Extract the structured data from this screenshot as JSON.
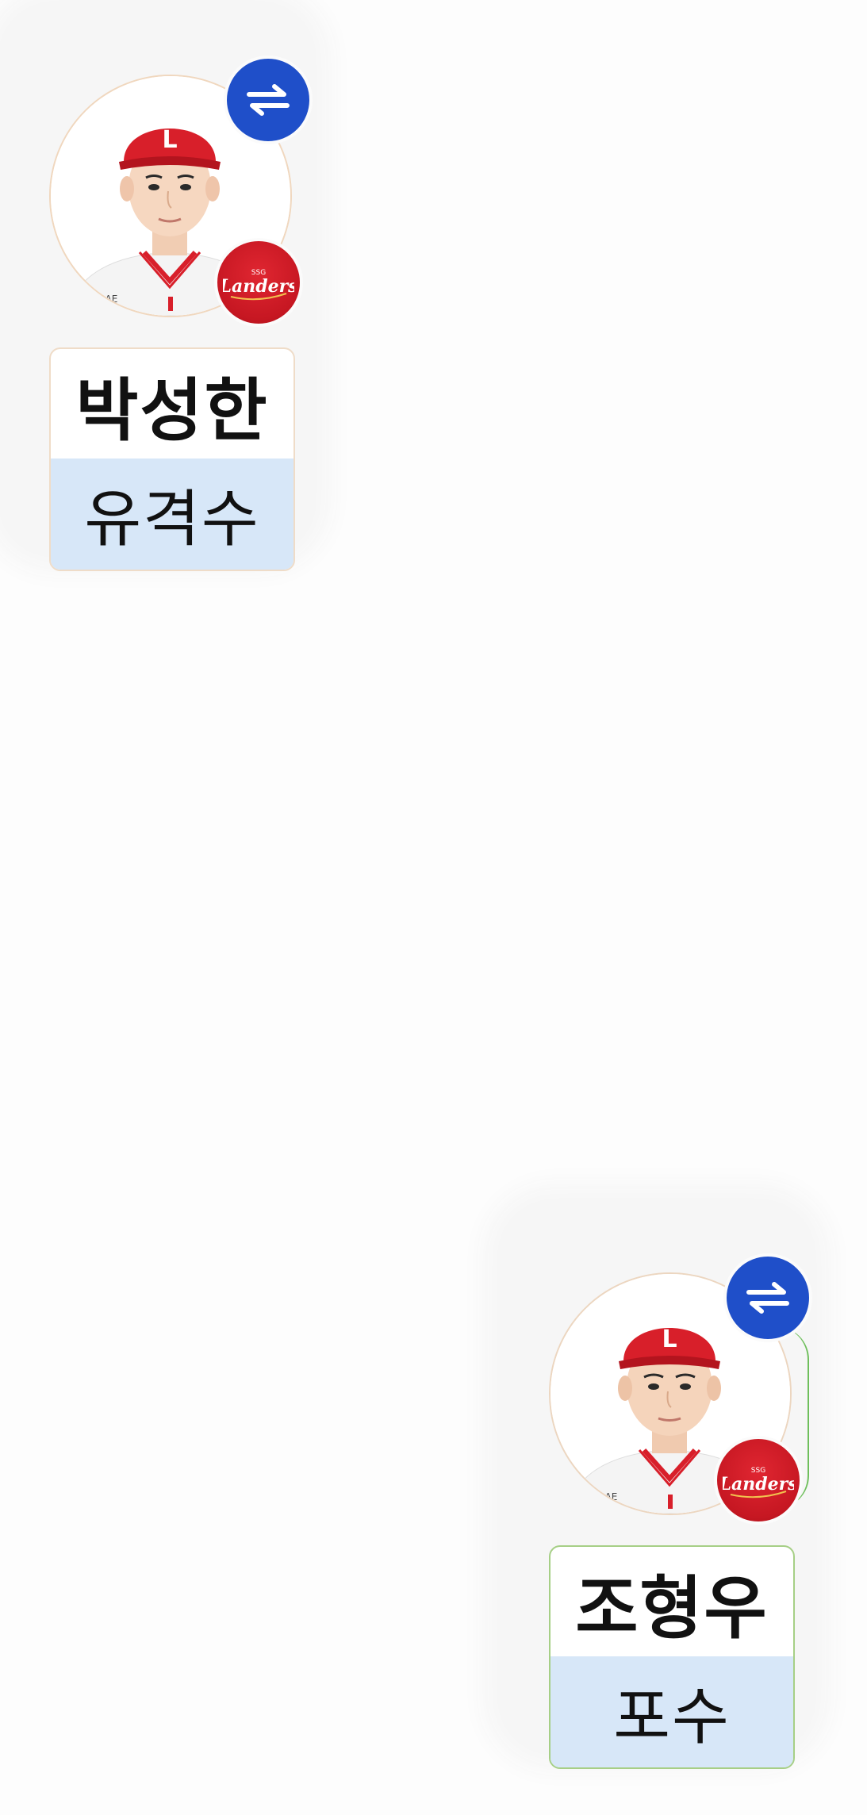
{
  "players": [
    {
      "name": "박성한",
      "position": "유격수",
      "team_logo_text": "Landers",
      "swap_icon": "swap-arrows-icon",
      "badge_color": "#1f4fc9",
      "team_color": "#c61722",
      "position_bg": "#d7e7f8"
    },
    {
      "name": "조형우",
      "position": "포수",
      "team_logo_text": "Landers",
      "swap_icon": "swap-arrows-icon",
      "badge_color": "#1f4fc9",
      "team_color": "#c61722",
      "position_bg": "#d7e7f8"
    }
  ]
}
